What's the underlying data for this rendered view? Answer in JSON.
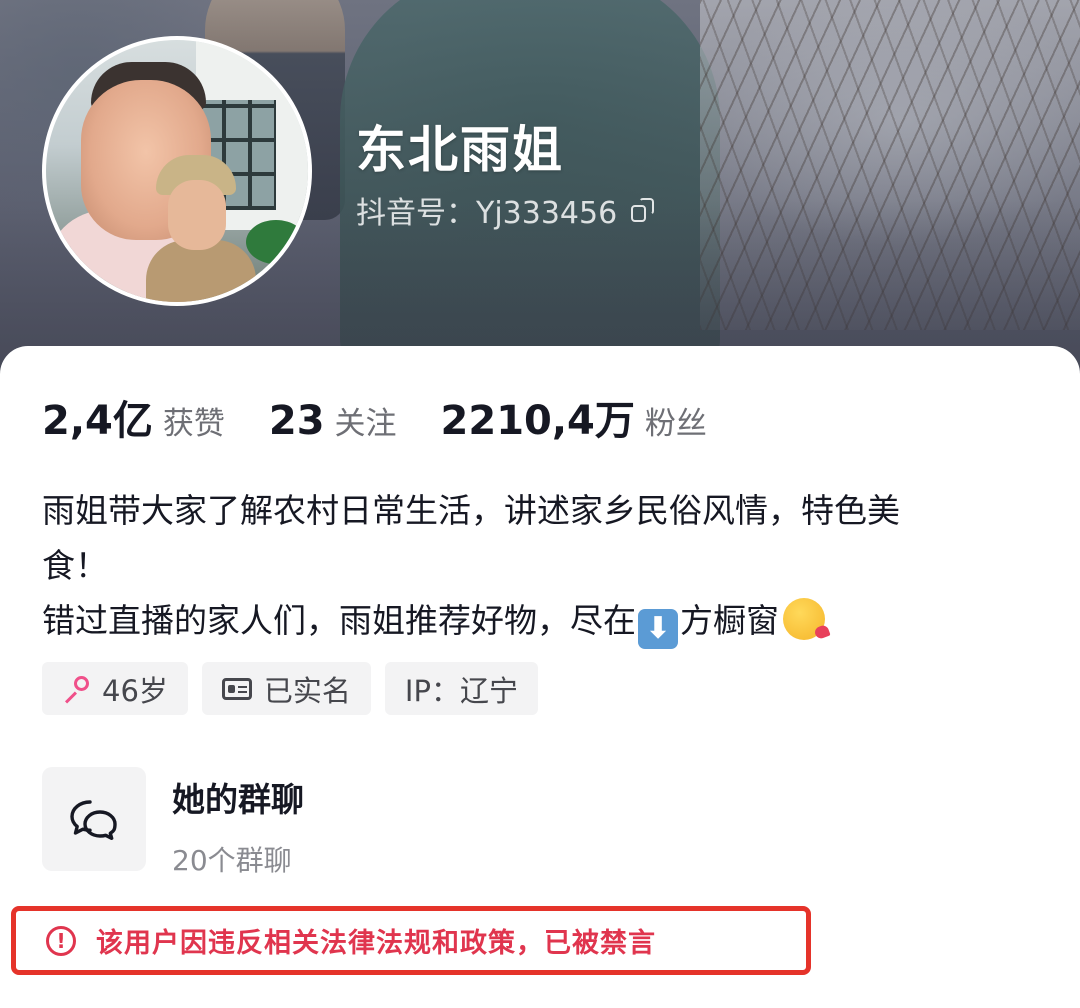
{
  "profile": {
    "nickname": "东北雨姐",
    "douyin_id": "抖音号：Yj333456"
  },
  "stats": [
    {
      "value": "2,4亿",
      "label": "获赞"
    },
    {
      "value": "23",
      "label": "关注"
    },
    {
      "value": "2210,4万",
      "label": "粉丝"
    }
  ],
  "bio": {
    "line1": "雨姐带大家了解农村日常生活，讲述家乡民俗风情，特色美",
    "line2": "食！",
    "line3_before": "错过直播的家人们，雨姐推荐好物，尽在",
    "down_arrow_emoji": "⬇",
    "line3_after": "方橱窗",
    "kiss_emoji_icon": "face-blowing-kiss-icon"
  },
  "tags": {
    "age": "46岁",
    "verified": "已实名",
    "ip": "IP：辽宁"
  },
  "group_chat": {
    "title": "她的群聊",
    "count": "20个群聊"
  },
  "ban_notice": {
    "text": "该用户因违反相关法律法规和政策，已被禁言",
    "color": "#e0354e",
    "border_color": "#e5332a"
  }
}
